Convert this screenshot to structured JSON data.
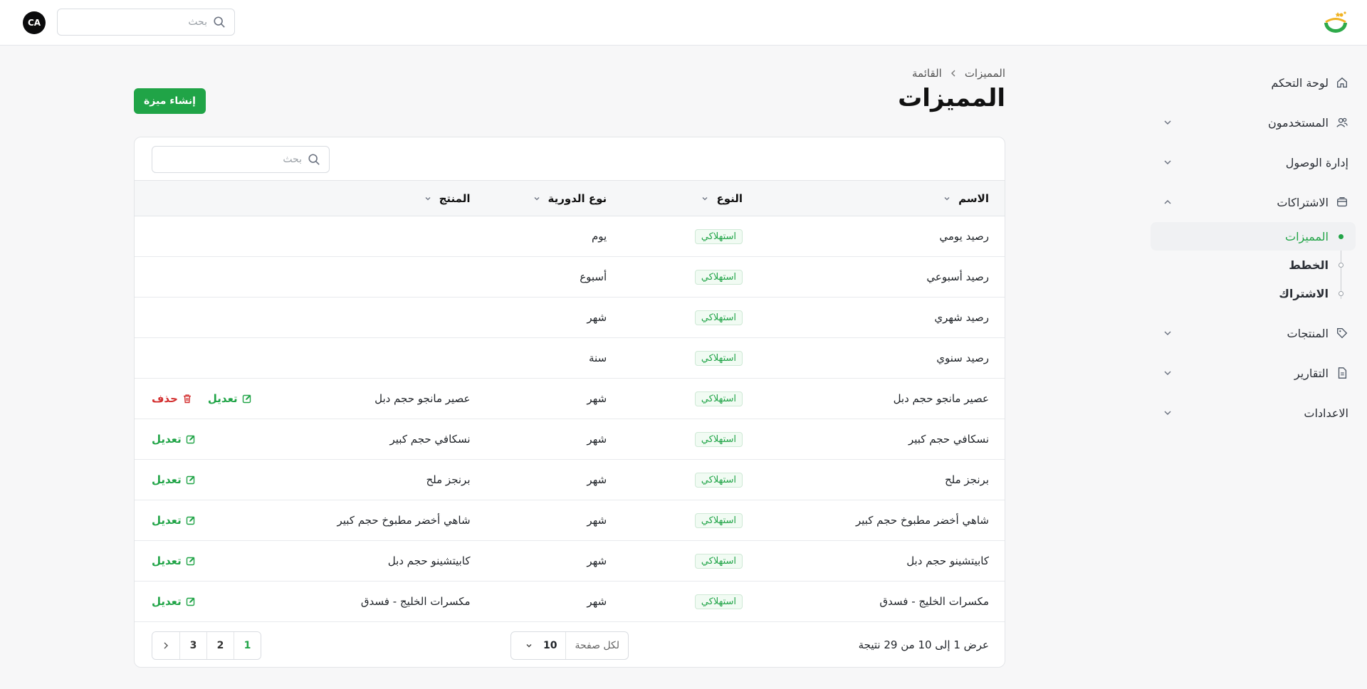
{
  "header": {
    "search_placeholder": "بحث",
    "avatar_initials": "CA",
    "logo_colors": {
      "primary": "#2eaa4a",
      "accent": "#f0b323"
    }
  },
  "sidebar": {
    "items": [
      {
        "label": "لوحة التحكم",
        "icon": "home-icon"
      },
      {
        "label": "المستخدمون",
        "icon": "users-icon"
      },
      {
        "label": "إدارة الوصول"
      },
      {
        "label": "الاشتراكات",
        "icon": "subscriptions-icon",
        "expanded": true
      },
      {
        "label": "المنتجات",
        "icon": "tag-icon"
      },
      {
        "label": "التقارير",
        "icon": "document-icon"
      },
      {
        "label": "الاعدادات"
      }
    ],
    "subscription_children": [
      {
        "label": "المميزات",
        "active": true
      },
      {
        "label": "الخطط"
      },
      {
        "label": "الاشتراك"
      }
    ]
  },
  "page": {
    "breadcrumb": [
      "المميزات",
      "القائمة"
    ],
    "title": "المميزات",
    "create_button": "إنشاء ميزة"
  },
  "table": {
    "search_placeholder": "بحث",
    "columns": [
      "الاسم",
      "النوع",
      "نوع الدورية",
      "المنتج"
    ],
    "edit_label": "تعديل",
    "delete_label": "حذف",
    "rows": [
      {
        "name": "رصيد يومي",
        "type": "استهلاكي",
        "period": "يوم",
        "product": "",
        "edit": false,
        "delete": false
      },
      {
        "name": "رصيد أسبوعي",
        "type": "استهلاكي",
        "period": "أسبوع",
        "product": "",
        "edit": false,
        "delete": false
      },
      {
        "name": "رصيد شهري",
        "type": "استهلاكي",
        "period": "شهر",
        "product": "",
        "edit": false,
        "delete": false
      },
      {
        "name": "رصيد سنوي",
        "type": "استهلاكي",
        "period": "سنة",
        "product": "",
        "edit": false,
        "delete": false
      },
      {
        "name": "عصير مانجو حجم دبل",
        "type": "استهلاكي",
        "period": "شهر",
        "product": "عصير مانجو حجم دبل",
        "edit": true,
        "delete": true
      },
      {
        "name": "نسكافي حجم كبير",
        "type": "استهلاكي",
        "period": "شهر",
        "product": "نسكافي حجم كبير",
        "edit": true,
        "delete": false
      },
      {
        "name": "برنجز ملح",
        "type": "استهلاكي",
        "period": "شهر",
        "product": "برنجز ملح",
        "edit": true,
        "delete": false
      },
      {
        "name": "شاهي أخضر مطبوخ حجم كبير",
        "type": "استهلاكي",
        "period": "شهر",
        "product": "شاهي أخضر مطبوخ حجم كبير",
        "edit": true,
        "delete": false
      },
      {
        "name": "كابيتشينو حجم دبل",
        "type": "استهلاكي",
        "period": "شهر",
        "product": "كابيتشينو حجم دبل",
        "edit": true,
        "delete": false
      },
      {
        "name": "مكسرات الخليج - فسدق",
        "type": "استهلاكي",
        "period": "شهر",
        "product": "مكسرات الخليج - فسدق",
        "edit": true,
        "delete": false
      }
    ]
  },
  "footer": {
    "results_text": "عرض 1 إلى 10 من 29 نتيجة",
    "per_page_label": "لكل صفحة",
    "per_page_value": "10",
    "pages": [
      "1",
      "2",
      "3"
    ],
    "current_page": "1"
  },
  "colors": {
    "accent": "#20a447",
    "danger": "#d32f2f"
  }
}
